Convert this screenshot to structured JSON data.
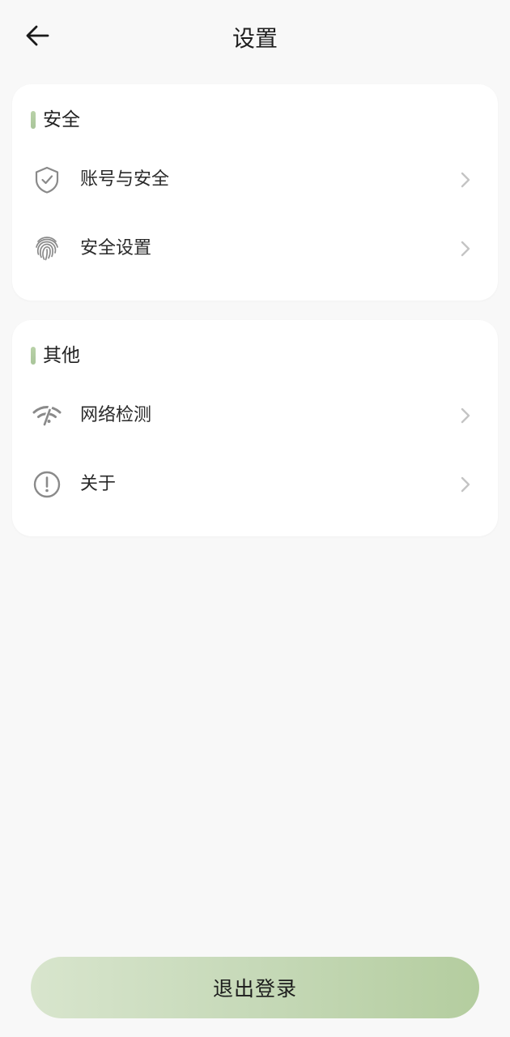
{
  "header": {
    "back_icon": "arrow-left-icon",
    "title": "设置"
  },
  "sections": [
    {
      "title": "安全",
      "accent": "#b5cfa3",
      "items": [
        {
          "label": "账号与安全",
          "icon": "shield-check-icon"
        },
        {
          "label": "安全设置",
          "icon": "fingerprint-icon"
        }
      ]
    },
    {
      "title": "其他",
      "accent": "#b5cfa3",
      "items": [
        {
          "label": "网络检测",
          "icon": "wifi-signal-icon"
        },
        {
          "label": "关于",
          "icon": "info-circle-icon"
        }
      ]
    }
  ],
  "chevron_icon": "chevron-right-icon",
  "footer": {
    "logout_label": "退出登录"
  },
  "colors": {
    "background": "#f8f8f8",
    "card": "#ffffff",
    "accent_green": "#b5cfa3",
    "icon_gray": "#8a8a8a",
    "chevron_gray": "#c4c4c4"
  }
}
